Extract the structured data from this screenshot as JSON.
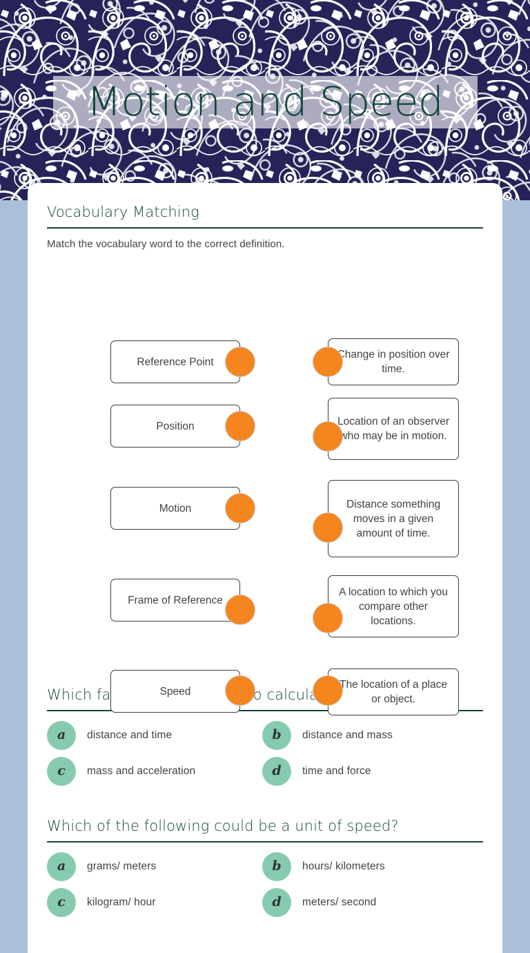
{
  "header": {
    "title": "Motion and Speed",
    "pattern_name": "paisley-doodle-pattern",
    "pattern_color": "#262358",
    "title_color": "#0d4237"
  },
  "theme": {
    "page_background": "#aac0da",
    "card_background": "#ffffff",
    "accent_green": "#13473c",
    "peg_orange": "#f5851f",
    "letter_circle_green": "#86cbb0",
    "body_text": "#3f4346"
  },
  "matching_section": {
    "heading": "Vocabulary Matching",
    "instruction": "Match the vocabulary word to the correct definition.",
    "terms": [
      {
        "label": "Reference Point"
      },
      {
        "label": "Position"
      },
      {
        "label": "Motion"
      },
      {
        "label": "Frame of Reference"
      },
      {
        "label": "Speed"
      }
    ],
    "definitions": [
      {
        "label": "Change in position over time."
      },
      {
        "label": "Location of an observer who may be in motion."
      },
      {
        "label": "Distance something moves in a given amount of time."
      },
      {
        "label": "A location to which you compare other locations."
      },
      {
        "label": "The location of a place or object."
      }
    ]
  },
  "questions": [
    {
      "prompt": "Which factors do you need to calculate speed?",
      "options": [
        {
          "letter": "a",
          "text": "distance and time"
        },
        {
          "letter": "b",
          "text": "distance and mass"
        },
        {
          "letter": "c",
          "text": "mass and acceleration"
        },
        {
          "letter": "d",
          "text": "time and force"
        }
      ]
    },
    {
      "prompt": "Which of the following could be a unit of speed?",
      "options": [
        {
          "letter": "a",
          "text": "grams/ meters"
        },
        {
          "letter": "b",
          "text": "hours/ kilometers"
        },
        {
          "letter": "c",
          "text": "kilogram/ hour"
        },
        {
          "letter": "d",
          "text": "meters/ second"
        }
      ]
    }
  ]
}
